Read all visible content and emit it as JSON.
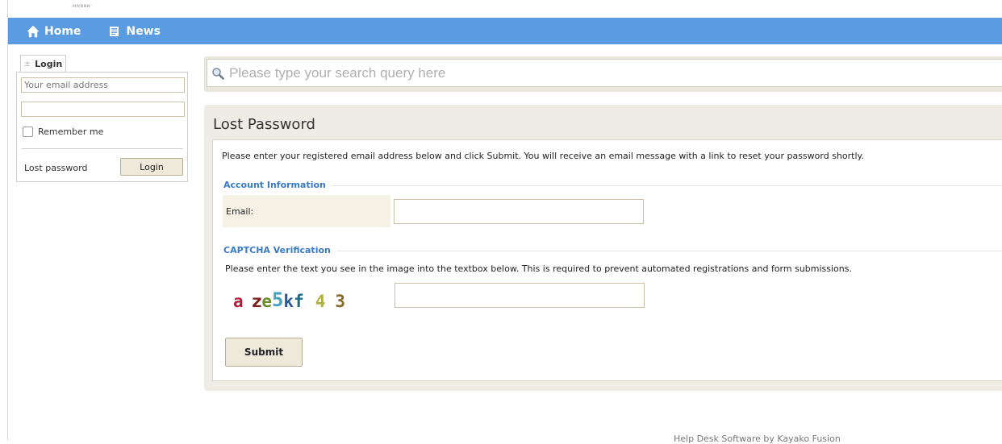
{
  "header": {
    "brand_text": "ᴍɴɴɴɴ·"
  },
  "nav": {
    "items": [
      {
        "label": "Home",
        "icon": "home-icon"
      },
      {
        "label": "News",
        "icon": "news-icon"
      }
    ]
  },
  "sidebar": {
    "tab_label": "Login",
    "email_placeholder": "Your email address",
    "password_value": "",
    "remember_label": "Remember me",
    "lost_password_label": "Lost password",
    "login_button_label": "Login"
  },
  "search": {
    "placeholder": "Please type your search query here"
  },
  "main": {
    "title": "Lost Password",
    "intro": "Please enter your registered email address below and click Submit. You will receive an email message with a link to reset your password shortly.",
    "account_section_title": "Account Information",
    "email_label": "Email:",
    "email_value": "",
    "captcha_section_title": "CAPTCHA Verification",
    "captcha_instructions": "Please enter the text you see in the image into the textbox below. This is required to prevent automated registrations and form submissions.",
    "captcha_chars": [
      {
        "ch": "a",
        "color": "#b0203a"
      },
      {
        "ch": "z",
        "color": "#7a1a1a"
      },
      {
        "ch": "e",
        "color": "#6b8a2a"
      },
      {
        "ch": "5",
        "color": "#4aa0c0"
      },
      {
        "ch": "k",
        "color": "#2a5a9a"
      },
      {
        "ch": "f",
        "color": "#1a6a8a"
      },
      {
        "ch": "4",
        "color": "#b0b040"
      },
      {
        "ch": "3",
        "color": "#8a6a2a"
      }
    ],
    "captcha_value": "",
    "submit_label": "Submit"
  },
  "footer": {
    "text": "Help Desk Software by Kayako Fusion"
  }
}
